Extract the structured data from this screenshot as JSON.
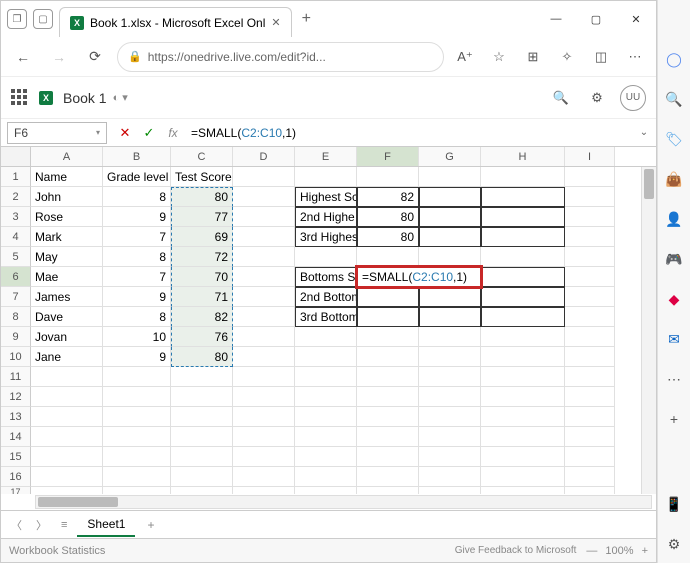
{
  "window": {
    "tab_title": "Book 1.xlsx - Microsoft Excel Onl"
  },
  "browser": {
    "url": "https://onedrive.live.com/edit?id..."
  },
  "app": {
    "doc_name": "Book 1",
    "user_initials": "UU"
  },
  "formula_bar": {
    "name_box": "F6",
    "formula_prefix": "=SMALL(",
    "formula_ref": "C2:C10",
    "formula_suffix": ",1)"
  },
  "columns": [
    "A",
    "B",
    "C",
    "D",
    "E",
    "F",
    "G",
    "H",
    "I"
  ],
  "sheet_tab": "Sheet1",
  "statusbar": {
    "stats_label": "Workbook Statistics",
    "feedback_label": "Give Feedback to Microsoft",
    "zoom": "100%"
  },
  "cells": {
    "A1": "Name",
    "B1": "Grade level",
    "C1": "Test Score",
    "A2": "John",
    "B2": "8",
    "C2": "80",
    "A3": "Rose",
    "B3": "9",
    "C3": "77",
    "A4": "Mark",
    "B4": "7",
    "C4": "69",
    "A5": "May",
    "B5": "8",
    "C5": "72",
    "A6": "Mae",
    "B6": "7",
    "C6": "70",
    "A7": "James",
    "B7": "9",
    "C7": "71",
    "A8": "Dave",
    "B8": "8",
    "C8": "82",
    "A9": "Jovan",
    "B9": "10",
    "C9": "76",
    "A10": "Jane",
    "B10": "9",
    "C10": "80",
    "E2": "Highest Sc",
    "F2": "82",
    "E3": "2nd Highe",
    "F3": "80",
    "E4": "3rd Highes",
    "F4": "80",
    "E6": "Bottoms S",
    "F6_prefix": "=SMALL(",
    "F6_ref": "C2:C10",
    "F6_suffix": ",1)",
    "E7": "2nd Bottom",
    "E8": "3rd Bottom"
  }
}
